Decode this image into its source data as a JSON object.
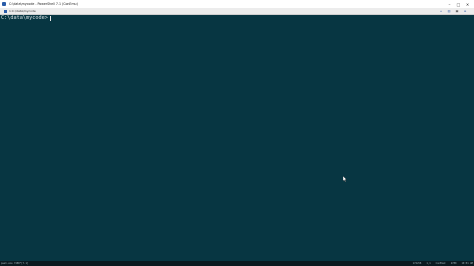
{
  "window": {
    "title": "C:\\data\\mycode - PowerShell 7.1 (ConEmu)",
    "controls": {
      "minimize_icon": "minimize-icon",
      "maximize_icon": "maximize-icon",
      "close_icon": "close-icon"
    }
  },
  "tabbar": {
    "tab_label": "1:C:\\data\\mycode",
    "tools": [
      "add-tab-icon",
      "split-icon",
      "lock-icon",
      "menu-icon"
    ]
  },
  "terminal": {
    "prompt": "C:\\data\\mycode>",
    "background": "#073642",
    "foreground": "#d7e0e2"
  },
  "statusbar": {
    "left": "pwsh.exe 7488*[7.1]",
    "right": [
      "174x58",
      "1,1",
      "ConEmuC",
      "2780",
      "10:51 AM"
    ]
  }
}
